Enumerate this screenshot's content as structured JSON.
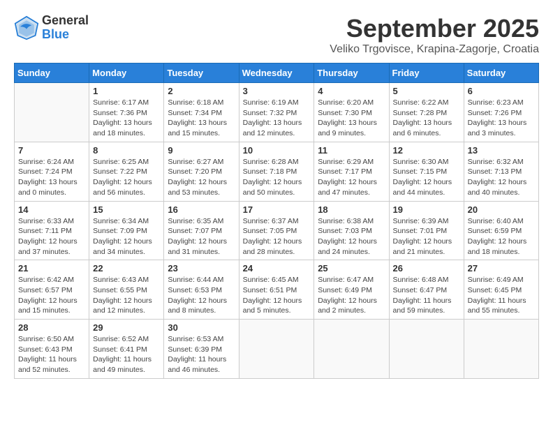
{
  "header": {
    "logo_general": "General",
    "logo_blue": "Blue",
    "month_title": "September 2025",
    "location": "Veliko Trgovisce, Krapina-Zagorje, Croatia"
  },
  "weekdays": [
    "Sunday",
    "Monday",
    "Tuesday",
    "Wednesday",
    "Thursday",
    "Friday",
    "Saturday"
  ],
  "weeks": [
    [
      {
        "day": "",
        "info": ""
      },
      {
        "day": "1",
        "info": "Sunrise: 6:17 AM\nSunset: 7:36 PM\nDaylight: 13 hours\nand 18 minutes."
      },
      {
        "day": "2",
        "info": "Sunrise: 6:18 AM\nSunset: 7:34 PM\nDaylight: 13 hours\nand 15 minutes."
      },
      {
        "day": "3",
        "info": "Sunrise: 6:19 AM\nSunset: 7:32 PM\nDaylight: 13 hours\nand 12 minutes."
      },
      {
        "day": "4",
        "info": "Sunrise: 6:20 AM\nSunset: 7:30 PM\nDaylight: 13 hours\nand 9 minutes."
      },
      {
        "day": "5",
        "info": "Sunrise: 6:22 AM\nSunset: 7:28 PM\nDaylight: 13 hours\nand 6 minutes."
      },
      {
        "day": "6",
        "info": "Sunrise: 6:23 AM\nSunset: 7:26 PM\nDaylight: 13 hours\nand 3 minutes."
      }
    ],
    [
      {
        "day": "7",
        "info": "Sunrise: 6:24 AM\nSunset: 7:24 PM\nDaylight: 13 hours\nand 0 minutes."
      },
      {
        "day": "8",
        "info": "Sunrise: 6:25 AM\nSunset: 7:22 PM\nDaylight: 12 hours\nand 56 minutes."
      },
      {
        "day": "9",
        "info": "Sunrise: 6:27 AM\nSunset: 7:20 PM\nDaylight: 12 hours\nand 53 minutes."
      },
      {
        "day": "10",
        "info": "Sunrise: 6:28 AM\nSunset: 7:18 PM\nDaylight: 12 hours\nand 50 minutes."
      },
      {
        "day": "11",
        "info": "Sunrise: 6:29 AM\nSunset: 7:17 PM\nDaylight: 12 hours\nand 47 minutes."
      },
      {
        "day": "12",
        "info": "Sunrise: 6:30 AM\nSunset: 7:15 PM\nDaylight: 12 hours\nand 44 minutes."
      },
      {
        "day": "13",
        "info": "Sunrise: 6:32 AM\nSunset: 7:13 PM\nDaylight: 12 hours\nand 40 minutes."
      }
    ],
    [
      {
        "day": "14",
        "info": "Sunrise: 6:33 AM\nSunset: 7:11 PM\nDaylight: 12 hours\nand 37 minutes."
      },
      {
        "day": "15",
        "info": "Sunrise: 6:34 AM\nSunset: 7:09 PM\nDaylight: 12 hours\nand 34 minutes."
      },
      {
        "day": "16",
        "info": "Sunrise: 6:35 AM\nSunset: 7:07 PM\nDaylight: 12 hours\nand 31 minutes."
      },
      {
        "day": "17",
        "info": "Sunrise: 6:37 AM\nSunset: 7:05 PM\nDaylight: 12 hours\nand 28 minutes."
      },
      {
        "day": "18",
        "info": "Sunrise: 6:38 AM\nSunset: 7:03 PM\nDaylight: 12 hours\nand 24 minutes."
      },
      {
        "day": "19",
        "info": "Sunrise: 6:39 AM\nSunset: 7:01 PM\nDaylight: 12 hours\nand 21 minutes."
      },
      {
        "day": "20",
        "info": "Sunrise: 6:40 AM\nSunset: 6:59 PM\nDaylight: 12 hours\nand 18 minutes."
      }
    ],
    [
      {
        "day": "21",
        "info": "Sunrise: 6:42 AM\nSunset: 6:57 PM\nDaylight: 12 hours\nand 15 minutes."
      },
      {
        "day": "22",
        "info": "Sunrise: 6:43 AM\nSunset: 6:55 PM\nDaylight: 12 hours\nand 12 minutes."
      },
      {
        "day": "23",
        "info": "Sunrise: 6:44 AM\nSunset: 6:53 PM\nDaylight: 12 hours\nand 8 minutes."
      },
      {
        "day": "24",
        "info": "Sunrise: 6:45 AM\nSunset: 6:51 PM\nDaylight: 12 hours\nand 5 minutes."
      },
      {
        "day": "25",
        "info": "Sunrise: 6:47 AM\nSunset: 6:49 PM\nDaylight: 12 hours\nand 2 minutes."
      },
      {
        "day": "26",
        "info": "Sunrise: 6:48 AM\nSunset: 6:47 PM\nDaylight: 11 hours\nand 59 minutes."
      },
      {
        "day": "27",
        "info": "Sunrise: 6:49 AM\nSunset: 6:45 PM\nDaylight: 11 hours\nand 55 minutes."
      }
    ],
    [
      {
        "day": "28",
        "info": "Sunrise: 6:50 AM\nSunset: 6:43 PM\nDaylight: 11 hours\nand 52 minutes."
      },
      {
        "day": "29",
        "info": "Sunrise: 6:52 AM\nSunset: 6:41 PM\nDaylight: 11 hours\nand 49 minutes."
      },
      {
        "day": "30",
        "info": "Sunrise: 6:53 AM\nSunset: 6:39 PM\nDaylight: 11 hours\nand 46 minutes."
      },
      {
        "day": "",
        "info": ""
      },
      {
        "day": "",
        "info": ""
      },
      {
        "day": "",
        "info": ""
      },
      {
        "day": "",
        "info": ""
      }
    ]
  ]
}
